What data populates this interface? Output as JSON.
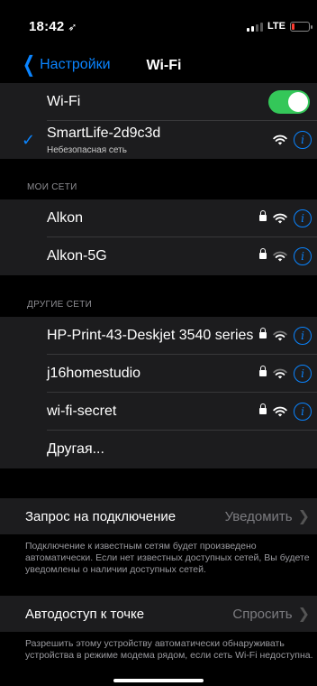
{
  "status_bar": {
    "time": "18:42",
    "location_icon": "location-arrow-icon",
    "network": "LTE",
    "signal_bars_active": 2,
    "signal_bars_total": 4,
    "battery_level": 0.12
  },
  "nav": {
    "back_label": "Настройки",
    "title": "Wi-Fi"
  },
  "wifi_toggle": {
    "label": "Wi-Fi",
    "on": true
  },
  "current_network": {
    "name": "SmartLife-2d9c3d",
    "subtitle": "Небезопасная сеть",
    "connected": true
  },
  "my_networks": {
    "header": "МОИ СЕТИ",
    "items": [
      {
        "name": "Alkon",
        "locked": true
      },
      {
        "name": "Alkon-5G",
        "locked": true
      }
    ]
  },
  "other_networks": {
    "header": "ДРУГИЕ СЕТИ",
    "items": [
      {
        "name": "HP-Print-43-Deskjet 3540 series",
        "locked": true
      },
      {
        "name": "j16homestudio",
        "locked": true
      },
      {
        "name": "wi-fi-secret",
        "locked": true
      }
    ],
    "other_label": "Другая..."
  },
  "ask_to_join": {
    "label": "Запрос на подключение",
    "value": "Уведомить",
    "footnote": "Подключение к известным сетям будет произведено автоматически. Если нет известных доступных сетей, Вы будете уведомлены о наличии доступных сетей."
  },
  "auto_hotspot": {
    "label": "Автодоступ к точке",
    "value": "Спросить",
    "footnote": "Разрешить этому устройству автоматически обнаруживать устройства в режиме модема рядом, если сеть Wi-Fi недоступна."
  },
  "colors": {
    "accent": "#0a84ff",
    "toggle_on": "#34c759",
    "cell_bg": "#1c1c1e"
  }
}
